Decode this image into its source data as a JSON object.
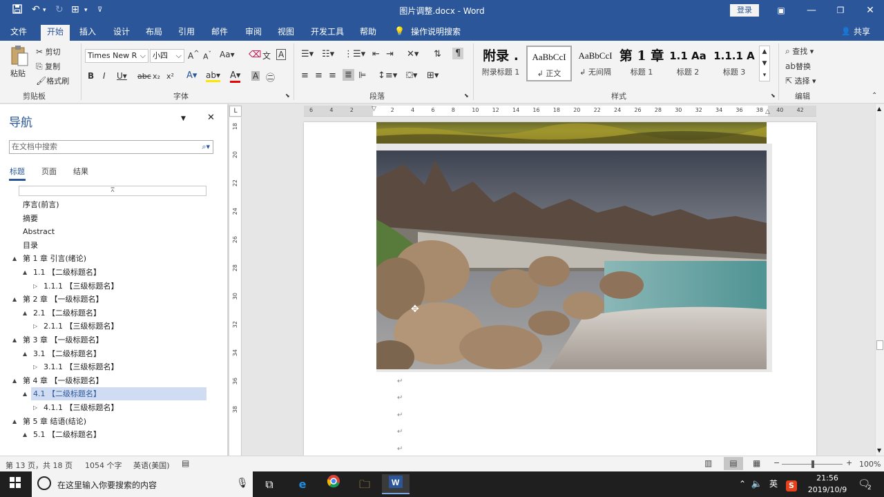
{
  "window": {
    "doc_title": "图片调整.docx  -  Word",
    "login_label": "登录",
    "share_label": "共享"
  },
  "tabs": [
    "文件",
    "开始",
    "插入",
    "设计",
    "布局",
    "引用",
    "邮件",
    "审阅",
    "视图",
    "开发工具",
    "帮助"
  ],
  "tell_me": "操作说明搜索",
  "ribbon": {
    "clipboard": {
      "paste": "粘贴",
      "cut": "剪切",
      "copy": "复制",
      "format_painter": "格式刷",
      "group": "剪贴板"
    },
    "font": {
      "name": "Times New R",
      "size": "小四",
      "group": "字体"
    },
    "paragraph": {
      "group": "段落"
    },
    "styles": {
      "group": "样式",
      "items": [
        {
          "sample": "附录 .",
          "name": "附录标题 1"
        },
        {
          "sample": "AaBbCcI",
          "name": "↲ 正文"
        },
        {
          "sample": "AaBbCcI",
          "name": "↲ 无间隔"
        },
        {
          "sample": "第 1 章",
          "name": "标题 1"
        },
        {
          "sample": "1.1  Aa",
          "name": "标题 2"
        },
        {
          "sample": "1.1.1  A",
          "name": "标题 3"
        }
      ]
    },
    "editing": {
      "find": "查找",
      "replace": "替换",
      "select": "选择",
      "group": "编辑"
    }
  },
  "nav": {
    "title": "导航",
    "search_placeholder": "在文档中搜索",
    "tabs": [
      "标题",
      "页面",
      "结果"
    ],
    "items": [
      {
        "label": "序言(前言)",
        "level": 0,
        "toggle": ""
      },
      {
        "label": "摘要",
        "level": 0,
        "toggle": ""
      },
      {
        "label": "Abstract",
        "level": 0,
        "toggle": ""
      },
      {
        "label": "目录",
        "level": 0,
        "toggle": ""
      },
      {
        "label": "第 1 章 引言(绪论)",
        "level": 0,
        "toggle": "▲"
      },
      {
        "label": "1.1 【二级标题名】",
        "level": 1,
        "toggle": "▲"
      },
      {
        "label": "1.1.1 【三级标题名】",
        "level": 2,
        "toggle": "▷"
      },
      {
        "label": "第 2 章 【一级标题名】",
        "level": 0,
        "toggle": "▲"
      },
      {
        "label": "2.1 【二级标题名】",
        "level": 1,
        "toggle": "▲"
      },
      {
        "label": "2.1.1 【三级标题名】",
        "level": 2,
        "toggle": "▷"
      },
      {
        "label": "第 3 章 【一级标题名】",
        "level": 0,
        "toggle": "▲"
      },
      {
        "label": "3.1 【二级标题名】",
        "level": 1,
        "toggle": "▲"
      },
      {
        "label": "3.1.1 【三级标题名】",
        "level": 2,
        "toggle": "▷"
      },
      {
        "label": "第 4 章 【一级标题名】",
        "level": 0,
        "toggle": "▲"
      },
      {
        "label": "4.1 【二级标题名】",
        "level": 1,
        "toggle": "▲",
        "selected": true
      },
      {
        "label": "4.1.1 【三级标题名】",
        "level": 2,
        "toggle": "▷"
      },
      {
        "label": "第 5 章 结语(结论)",
        "level": 0,
        "toggle": "▲"
      },
      {
        "label": "5.1 【二级标题名】",
        "level": 1,
        "toggle": "▲"
      }
    ]
  },
  "ruler": {
    "h_ticks": [
      "6",
      "4",
      "2",
      "",
      "2",
      "4",
      "6",
      "8",
      "10",
      "12",
      "14",
      "16",
      "18",
      "20",
      "22",
      "24",
      "26",
      "28",
      "30",
      "32",
      "34",
      "36",
      "38",
      "40",
      "42"
    ],
    "v_ticks": [
      "18",
      "20",
      "22",
      "24",
      "26",
      "28",
      "30",
      "32",
      "34",
      "36",
      "38"
    ]
  },
  "status": {
    "page": "第 13 页，共 18 页",
    "words": "1054 个字",
    "lang": "英语(美国)",
    "zoom": "100%"
  },
  "taskbar": {
    "search_placeholder": "在这里输入你要搜索的内容",
    "ime": "英",
    "time": "21:56",
    "date": "2019/10/9",
    "notifications": "2"
  }
}
